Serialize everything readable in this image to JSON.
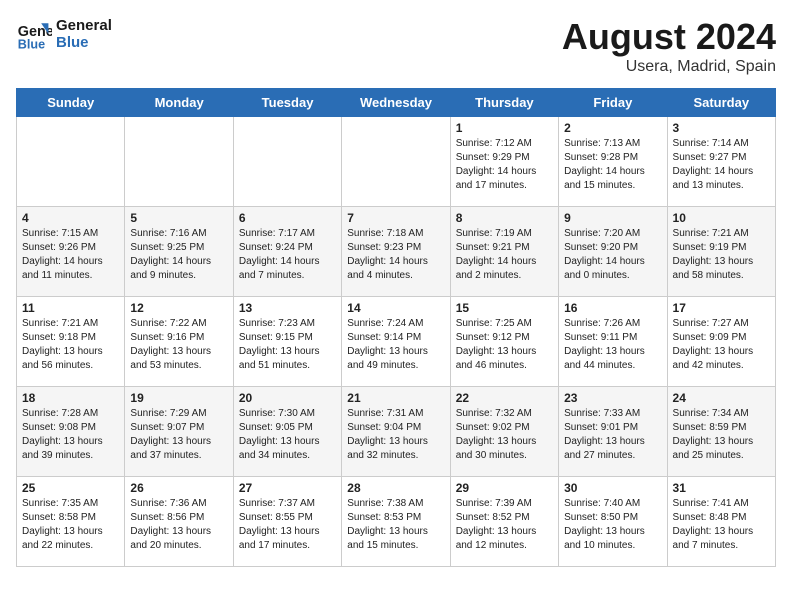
{
  "header": {
    "logo_line1": "General",
    "logo_line2": "Blue",
    "title": "August 2024",
    "subtitle": "Usera, Madrid, Spain"
  },
  "weekdays": [
    "Sunday",
    "Monday",
    "Tuesday",
    "Wednesday",
    "Thursday",
    "Friday",
    "Saturday"
  ],
  "weeks": [
    [
      {
        "day": "",
        "sunrise": "",
        "sunset": "",
        "daylight": ""
      },
      {
        "day": "",
        "sunrise": "",
        "sunset": "",
        "daylight": ""
      },
      {
        "day": "",
        "sunrise": "",
        "sunset": "",
        "daylight": ""
      },
      {
        "day": "",
        "sunrise": "",
        "sunset": "",
        "daylight": ""
      },
      {
        "day": "1",
        "sunrise": "Sunrise: 7:12 AM",
        "sunset": "Sunset: 9:29 PM",
        "daylight": "Daylight: 14 hours and 17 minutes."
      },
      {
        "day": "2",
        "sunrise": "Sunrise: 7:13 AM",
        "sunset": "Sunset: 9:28 PM",
        "daylight": "Daylight: 14 hours and 15 minutes."
      },
      {
        "day": "3",
        "sunrise": "Sunrise: 7:14 AM",
        "sunset": "Sunset: 9:27 PM",
        "daylight": "Daylight: 14 hours and 13 minutes."
      }
    ],
    [
      {
        "day": "4",
        "sunrise": "Sunrise: 7:15 AM",
        "sunset": "Sunset: 9:26 PM",
        "daylight": "Daylight: 14 hours and 11 minutes."
      },
      {
        "day": "5",
        "sunrise": "Sunrise: 7:16 AM",
        "sunset": "Sunset: 9:25 PM",
        "daylight": "Daylight: 14 hours and 9 minutes."
      },
      {
        "day": "6",
        "sunrise": "Sunrise: 7:17 AM",
        "sunset": "Sunset: 9:24 PM",
        "daylight": "Daylight: 14 hours and 7 minutes."
      },
      {
        "day": "7",
        "sunrise": "Sunrise: 7:18 AM",
        "sunset": "Sunset: 9:23 PM",
        "daylight": "Daylight: 14 hours and 4 minutes."
      },
      {
        "day": "8",
        "sunrise": "Sunrise: 7:19 AM",
        "sunset": "Sunset: 9:21 PM",
        "daylight": "Daylight: 14 hours and 2 minutes."
      },
      {
        "day": "9",
        "sunrise": "Sunrise: 7:20 AM",
        "sunset": "Sunset: 9:20 PM",
        "daylight": "Daylight: 14 hours and 0 minutes."
      },
      {
        "day": "10",
        "sunrise": "Sunrise: 7:21 AM",
        "sunset": "Sunset: 9:19 PM",
        "daylight": "Daylight: 13 hours and 58 minutes."
      }
    ],
    [
      {
        "day": "11",
        "sunrise": "Sunrise: 7:21 AM",
        "sunset": "Sunset: 9:18 PM",
        "daylight": "Daylight: 13 hours and 56 minutes."
      },
      {
        "day": "12",
        "sunrise": "Sunrise: 7:22 AM",
        "sunset": "Sunset: 9:16 PM",
        "daylight": "Daylight: 13 hours and 53 minutes."
      },
      {
        "day": "13",
        "sunrise": "Sunrise: 7:23 AM",
        "sunset": "Sunset: 9:15 PM",
        "daylight": "Daylight: 13 hours and 51 minutes."
      },
      {
        "day": "14",
        "sunrise": "Sunrise: 7:24 AM",
        "sunset": "Sunset: 9:14 PM",
        "daylight": "Daylight: 13 hours and 49 minutes."
      },
      {
        "day": "15",
        "sunrise": "Sunrise: 7:25 AM",
        "sunset": "Sunset: 9:12 PM",
        "daylight": "Daylight: 13 hours and 46 minutes."
      },
      {
        "day": "16",
        "sunrise": "Sunrise: 7:26 AM",
        "sunset": "Sunset: 9:11 PM",
        "daylight": "Daylight: 13 hours and 44 minutes."
      },
      {
        "day": "17",
        "sunrise": "Sunrise: 7:27 AM",
        "sunset": "Sunset: 9:09 PM",
        "daylight": "Daylight: 13 hours and 42 minutes."
      }
    ],
    [
      {
        "day": "18",
        "sunrise": "Sunrise: 7:28 AM",
        "sunset": "Sunset: 9:08 PM",
        "daylight": "Daylight: 13 hours and 39 minutes."
      },
      {
        "day": "19",
        "sunrise": "Sunrise: 7:29 AM",
        "sunset": "Sunset: 9:07 PM",
        "daylight": "Daylight: 13 hours and 37 minutes."
      },
      {
        "day": "20",
        "sunrise": "Sunrise: 7:30 AM",
        "sunset": "Sunset: 9:05 PM",
        "daylight": "Daylight: 13 hours and 34 minutes."
      },
      {
        "day": "21",
        "sunrise": "Sunrise: 7:31 AM",
        "sunset": "Sunset: 9:04 PM",
        "daylight": "Daylight: 13 hours and 32 minutes."
      },
      {
        "day": "22",
        "sunrise": "Sunrise: 7:32 AM",
        "sunset": "Sunset: 9:02 PM",
        "daylight": "Daylight: 13 hours and 30 minutes."
      },
      {
        "day": "23",
        "sunrise": "Sunrise: 7:33 AM",
        "sunset": "Sunset: 9:01 PM",
        "daylight": "Daylight: 13 hours and 27 minutes."
      },
      {
        "day": "24",
        "sunrise": "Sunrise: 7:34 AM",
        "sunset": "Sunset: 8:59 PM",
        "daylight": "Daylight: 13 hours and 25 minutes."
      }
    ],
    [
      {
        "day": "25",
        "sunrise": "Sunrise: 7:35 AM",
        "sunset": "Sunset: 8:58 PM",
        "daylight": "Daylight: 13 hours and 22 minutes."
      },
      {
        "day": "26",
        "sunrise": "Sunrise: 7:36 AM",
        "sunset": "Sunset: 8:56 PM",
        "daylight": "Daylight: 13 hours and 20 minutes."
      },
      {
        "day": "27",
        "sunrise": "Sunrise: 7:37 AM",
        "sunset": "Sunset: 8:55 PM",
        "daylight": "Daylight: 13 hours and 17 minutes."
      },
      {
        "day": "28",
        "sunrise": "Sunrise: 7:38 AM",
        "sunset": "Sunset: 8:53 PM",
        "daylight": "Daylight: 13 hours and 15 minutes."
      },
      {
        "day": "29",
        "sunrise": "Sunrise: 7:39 AM",
        "sunset": "Sunset: 8:52 PM",
        "daylight": "Daylight: 13 hours and 12 minutes."
      },
      {
        "day": "30",
        "sunrise": "Sunrise: 7:40 AM",
        "sunset": "Sunset: 8:50 PM",
        "daylight": "Daylight: 13 hours and 10 minutes."
      },
      {
        "day": "31",
        "sunrise": "Sunrise: 7:41 AM",
        "sunset": "Sunset: 8:48 PM",
        "daylight": "Daylight: 13 hours and 7 minutes."
      }
    ]
  ]
}
